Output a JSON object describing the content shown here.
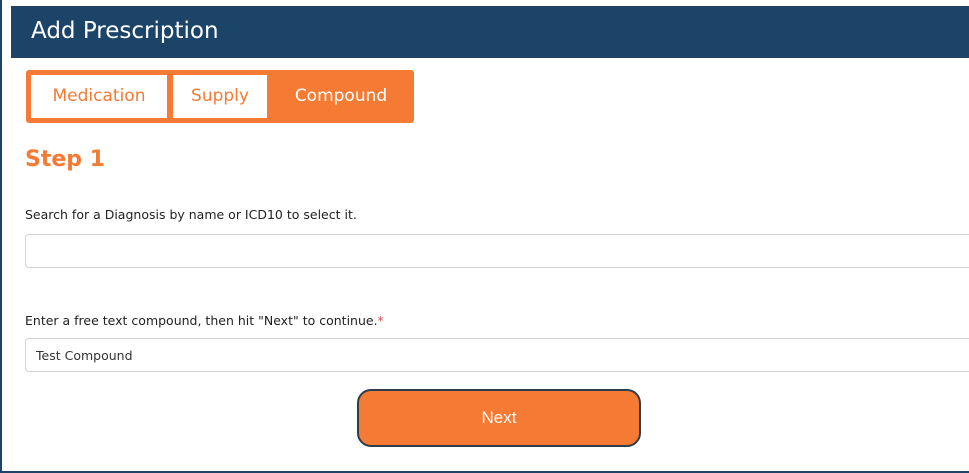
{
  "header": {
    "title": "Add Prescription"
  },
  "tabs": [
    {
      "label": "Medication",
      "state": "inactive"
    },
    {
      "label": "Supply",
      "state": "inactive"
    },
    {
      "label": "Compound",
      "state": "active"
    }
  ],
  "step": {
    "title": "Step 1"
  },
  "diagnosis": {
    "label": "Search for a Diagnosis by name or ICD10 to select it.",
    "value": "",
    "placeholder": ""
  },
  "compound": {
    "label": "Enter a free text compound, then hit \"Next\" to continue.",
    "required_mark": "*",
    "value": "Test Compound"
  },
  "actions": {
    "next_label": "Next"
  },
  "colors": {
    "header_bg": "#1c4468",
    "accent": "#f57b34",
    "required": "#d9534f"
  }
}
